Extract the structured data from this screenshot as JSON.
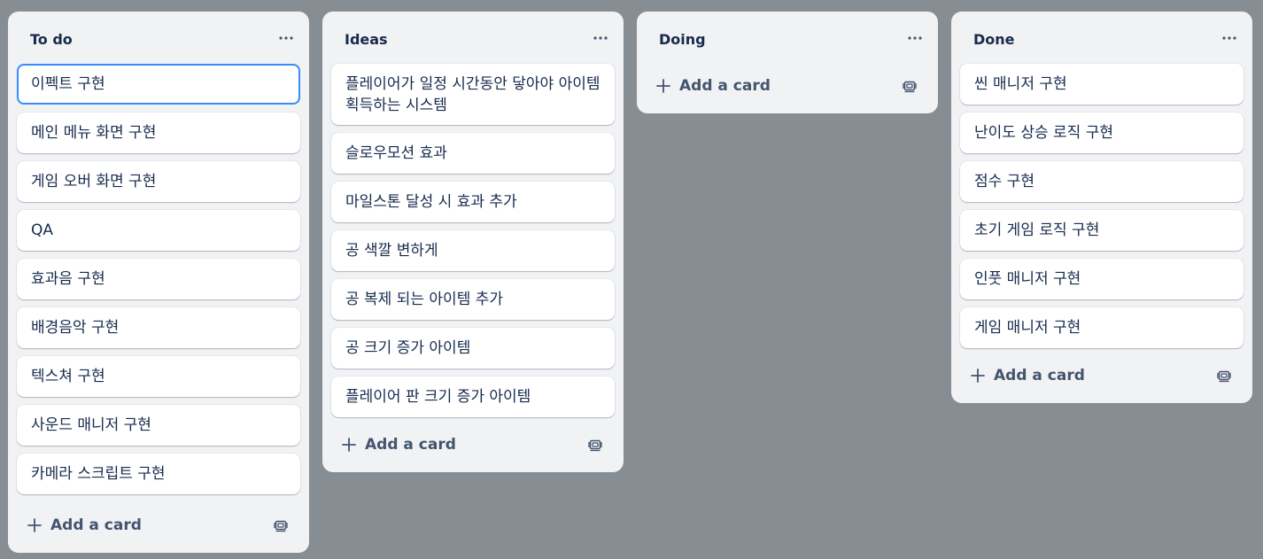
{
  "colors": {
    "board_background": "#868d93",
    "list_background": "#f1f2f4",
    "card_background": "#ffffff",
    "text": "#172b4d",
    "focus_ring": "#388bff"
  },
  "lists": [
    {
      "title": "To do",
      "menu_icon": "ellipsis-icon",
      "cards": [
        "이펙트 구현",
        "메인 메뉴 화면 구현",
        "게임 오버 화면 구현",
        "QA",
        "효과음 구현",
        "배경음악 구현",
        "텍스쳐 구현",
        "사운드 매니저 구현",
        "카메라 스크립트 구현"
      ],
      "add_label": "Add a card",
      "template_icon": "card-template-icon"
    },
    {
      "title": "Ideas",
      "menu_icon": "ellipsis-icon",
      "cards": [
        "플레이어가 일정 시간동안 닿아야 아이템 획득하는 시스템",
        "슬로우모션 효과",
        "마일스톤 달성 시 효과 추가",
        "공 색깔 변하게",
        "공 복제 되는 아이템 추가",
        "공 크기 증가 아이템",
        "플레이어 판 크기 증가 아이템"
      ],
      "add_label": "Add a card",
      "template_icon": "card-template-icon"
    },
    {
      "title": "Doing",
      "menu_icon": "ellipsis-icon",
      "cards": [],
      "add_label": "Add a card",
      "template_icon": "card-template-icon"
    },
    {
      "title": "Done",
      "menu_icon": "ellipsis-icon",
      "cards": [
        "씬 매니저 구현",
        "난이도 상승 로직 구현",
        "점수 구현",
        "초기 게임 로직 구현",
        "인풋 매니저 구현",
        "게임 매니저 구현"
      ],
      "add_label": "Add a card",
      "template_icon": "card-template-icon"
    }
  ]
}
